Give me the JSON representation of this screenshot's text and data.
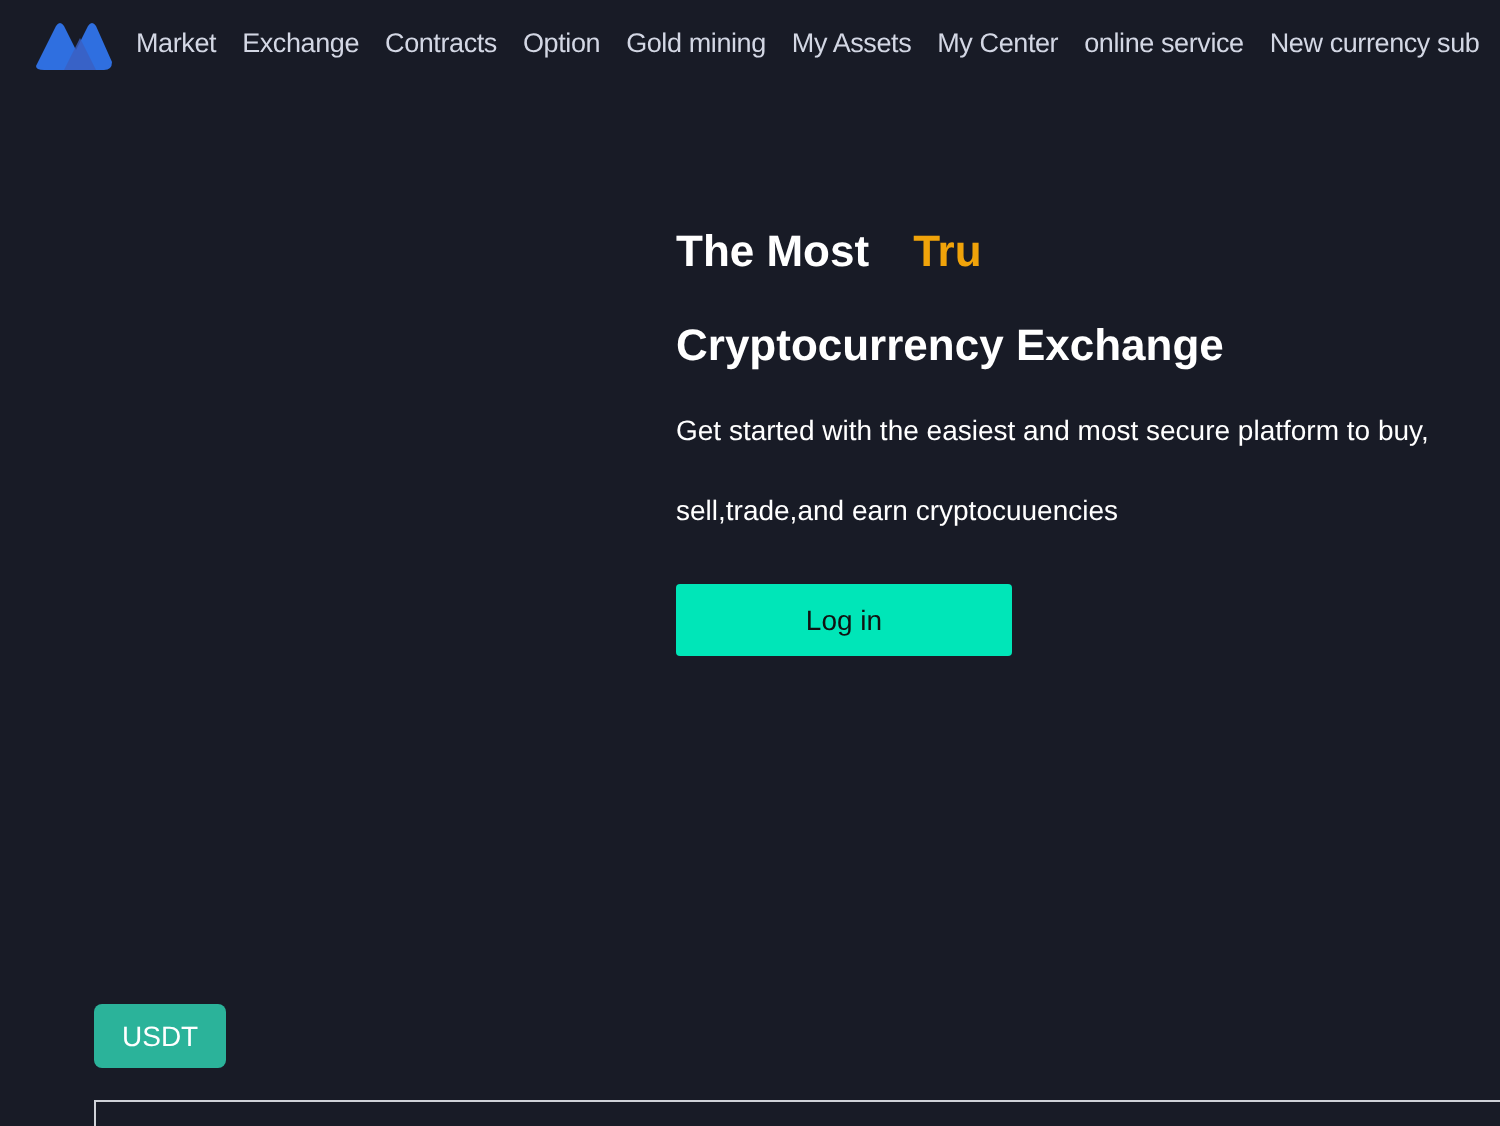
{
  "nav": {
    "items": [
      "Market",
      "Exchange",
      "Contracts",
      "Option",
      "Gold mining",
      "My Assets",
      "My Center",
      "online service",
      "New currency sub"
    ]
  },
  "hero": {
    "title_start": "The Most",
    "title_highlight": "Tru",
    "title_line2": "Cryptocurrency Exchange",
    "lines": [
      "Get started with the easiest and most secure platform to buy,",
      "sell,trade,and earn cryptocuuencies"
    ],
    "button": "Log in"
  },
  "currency_tabs": [
    {
      "label": "USDT",
      "selected": true
    }
  ]
}
